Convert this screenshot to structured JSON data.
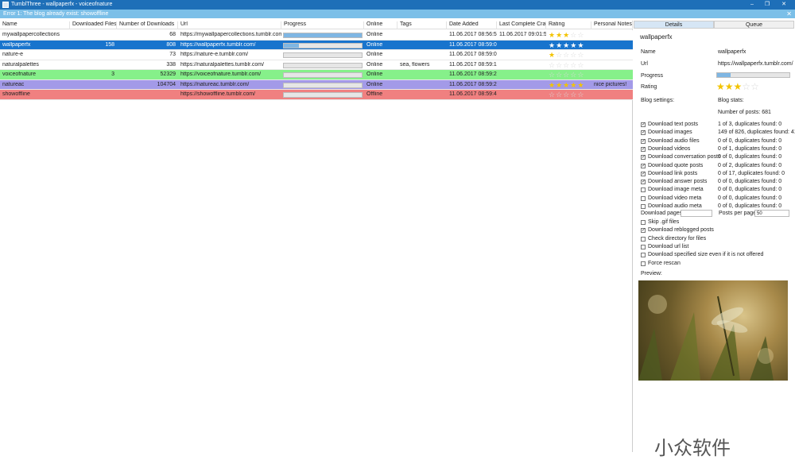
{
  "window": {
    "title": "TumblThree - wallpaperfx - voiceofnature",
    "min": "–",
    "max": "❐",
    "close": "✕"
  },
  "error_bar": {
    "message": "Error 1: The blog already exist: showoffline",
    "close": "✕"
  },
  "grid": {
    "columns": [
      "Name",
      "Downloaded Files",
      "Number of Downloads",
      "Url",
      "Progress",
      "Online",
      "Tags",
      "Date Added",
      "Last Complete Crawl",
      "Rating",
      "Personal Notes"
    ],
    "rows": [
      {
        "name": "mywallpapercollections",
        "downloaded": "",
        "number": "68",
        "url": "https://mywallpapercollections.tumblr.com/",
        "progress": 1.0,
        "online": "Online",
        "tags": "",
        "date_added": "11.06.2017 08:56:57",
        "last_crawl": "11.06.2017 09:01:50",
        "rating": 3,
        "notes": "",
        "bg": "#ffffff"
      },
      {
        "name": "wallpaperfx",
        "downloaded": "158",
        "number": "808",
        "url": "https://wallpaperfx.tumblr.com/",
        "progress": 0.19,
        "online": "Online",
        "tags": "",
        "date_added": "11.06.2017 08:59:03",
        "last_crawl": "",
        "rating": 5,
        "notes": "",
        "bg": "#1874cd"
      },
      {
        "name": "nature-e",
        "downloaded": "",
        "number": "73",
        "url": "https://nature-e.tumblr.com/",
        "progress": 0.0,
        "online": "Online",
        "tags": "",
        "date_added": "11.06.2017 08:59:08",
        "last_crawl": "",
        "rating": 1,
        "notes": "",
        "bg": "#ffffff"
      },
      {
        "name": "naturalpalettes",
        "downloaded": "",
        "number": "338",
        "url": "https://naturalpalettes.tumblr.com/",
        "progress": 0.0,
        "online": "Online",
        "tags": "sea, flowers",
        "date_added": "11.06.2017 08:59:14",
        "last_crawl": "",
        "rating": 0,
        "notes": "",
        "bg": "#ffffff"
      },
      {
        "name": "voiceofnature",
        "downloaded": "3",
        "number": "52329",
        "url": "https://voiceofnature.tumblr.com/",
        "progress": 0.0,
        "online": "Online",
        "tags": "",
        "date_added": "11.06.2017 08:59:23",
        "last_crawl": "",
        "rating": 0,
        "notes": "",
        "bg": "#86f08a"
      },
      {
        "name": "natureac",
        "downloaded": "",
        "number": "104704",
        "url": "https://natureac.tumblr.com/",
        "progress": 0.0,
        "online": "Online",
        "tags": "",
        "date_added": "11.06.2017 08:59:29",
        "last_crawl": "",
        "rating": 5,
        "notes": "nice pictures!",
        "bg": "#a39ae8"
      },
      {
        "name": "showoffline",
        "downloaded": "",
        "number": "",
        "url": "https://showoffline.tumblr.com/",
        "progress": 0.0,
        "online": "Offline",
        "tags": "",
        "date_added": "11.06.2017 08:59:42",
        "last_crawl": "",
        "rating": 0,
        "notes": "",
        "bg": "#f08080"
      }
    ]
  },
  "details": {
    "tabs": [
      "Details",
      "Queue"
    ],
    "blog_title": "wallpaperfx",
    "name_label": "Name",
    "name_value": "wallpaperfx",
    "url_label": "Url",
    "url_value": "https://wallpaperfx.tumblr.com/",
    "progress_label": "Progress",
    "progress_value": 0.19,
    "rating_label": "Rating",
    "rating_value": 3,
    "settings_label": "Blog settings:",
    "stats_label": "Blog stats:",
    "number_of_posts": "Number of posts: 681",
    "checks": [
      {
        "label": "Download text posts",
        "checked": true,
        "stat": "1 of 3, duplicates found: 0"
      },
      {
        "label": "Download images",
        "checked": true,
        "stat": "149 of 826, duplicates found: 41"
      },
      {
        "label": "Download audio files",
        "checked": true,
        "stat": "0 of 0, duplicates found: 0"
      },
      {
        "label": "Download videos",
        "checked": true,
        "stat": "0 of 1, duplicates found: 0"
      },
      {
        "label": "Download conversation posts",
        "checked": true,
        "stat": "0 of 0, duplicates found: 0"
      },
      {
        "label": "Download quote posts",
        "checked": true,
        "stat": "0 of 2, duplicates found: 0"
      },
      {
        "label": "Download link posts",
        "checked": true,
        "stat": "0 of 17, duplicates found: 0"
      },
      {
        "label": "Download answer posts",
        "checked": true,
        "stat": "0 of 0, duplicates found: 0"
      },
      {
        "label": "Download image meta",
        "checked": false,
        "stat": "0 of 0, duplicates found: 0"
      },
      {
        "label": "Download video meta",
        "checked": false,
        "stat": "0 of 0, duplicates found: 0"
      },
      {
        "label": "Download audio meta",
        "checked": false,
        "stat": "0 of 0, duplicates found: 0"
      }
    ],
    "download_pages_label": "Download pages:",
    "download_pages_value": "",
    "posts_per_page_label": "Posts per page:",
    "posts_per_page_value": "50",
    "options": [
      {
        "label": "Skip .gif files",
        "checked": false
      },
      {
        "label": "Download reblogged posts",
        "checked": true
      },
      {
        "label": "Check directory for files",
        "checked": false
      },
      {
        "label": "Download url list",
        "checked": false
      },
      {
        "label": "Download specified size even if it is not offered",
        "checked": false
      },
      {
        "label": "Force rescan",
        "checked": false
      }
    ],
    "preview_label": "Preview:"
  },
  "watermark": "小众软件"
}
